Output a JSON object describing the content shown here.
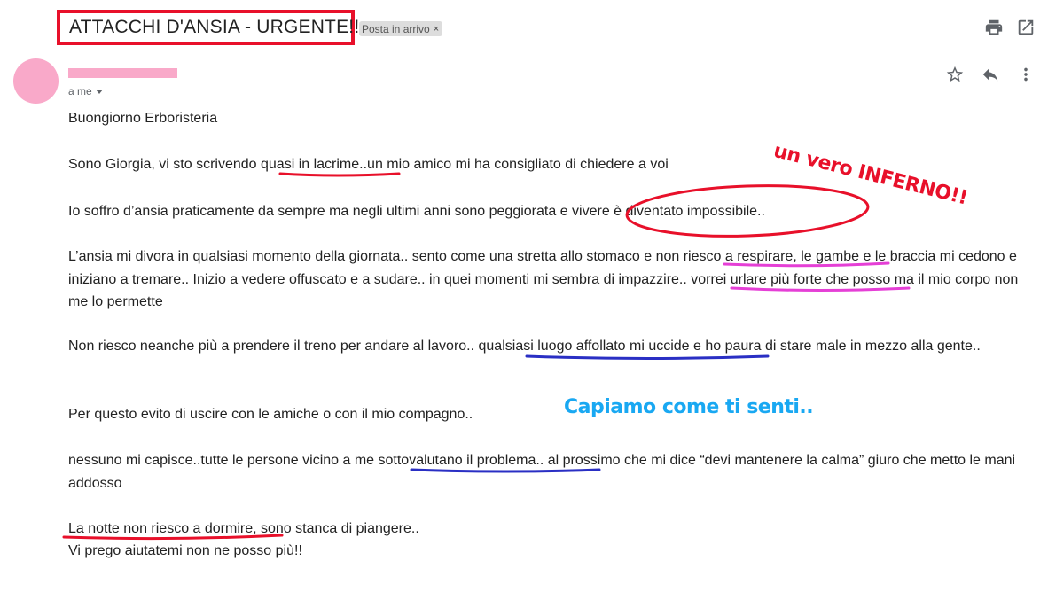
{
  "header": {
    "subject": "ATTACCHI D'ANSIA - URGENTE!!",
    "label_chip": "Posta in arrivo",
    "label_chip_close": "×",
    "print_icon": "print-icon",
    "open_new_window_icon": "open-in-new-window-icon"
  },
  "message": {
    "recipient": "a me",
    "actions": {
      "star_icon": "star-icon",
      "reply_icon": "reply-icon",
      "more_icon": "more-vertical-icon"
    },
    "body": [
      "Buongiorno Erboristeria",
      "Sono Giorgia, vi sto scrivendo quasi in lacrime..un mio amico mi ha consigliato di chiedere a voi",
      "Io soffro d’ansia praticamente da sempre ma negli ultimi anni sono peggiorata e vivere è diventato impossibile..",
      "L’ansia mi divora in qualsiasi momento della giornata.. sento come una stretta allo stomaco e non riesco a respirare, le gambe e le braccia mi cedono e iniziano a tremare.. Inizio a vedere offuscato e a sudare.. in quei momenti mi sembra di impazzire.. vorrei urlare più forte che posso ma il mio corpo non me lo permette",
      "Non riesco neanche più a prendere il treno per andare al lavoro.. qualsiasi luogo affollato mi uccide e ho paura di stare male in mezzo alla gente..",
      "Per questo evito di uscire con le amiche o con il mio compagno..",
      "nessuno mi capisce..tutte le persone vicino a me sottovalutano il problema.. al prossimo che mi dice “devi mantenere la calma”  giuro che metto le mani addosso",
      "La notte non riesco a dormire, sono stanca di piangere..",
      "Vi prego aiutatemi non ne posso più!!"
    ]
  },
  "annotations": {
    "red_note": "un vero INFERNO!!",
    "blue_note": "Capiamo come ti senti..",
    "colors": {
      "red": "#e8102a",
      "pink": "#e53fd6",
      "blue": "#2a2fc4",
      "light_blue": "#19a8f2",
      "avatar": "#f9a9c9"
    }
  }
}
